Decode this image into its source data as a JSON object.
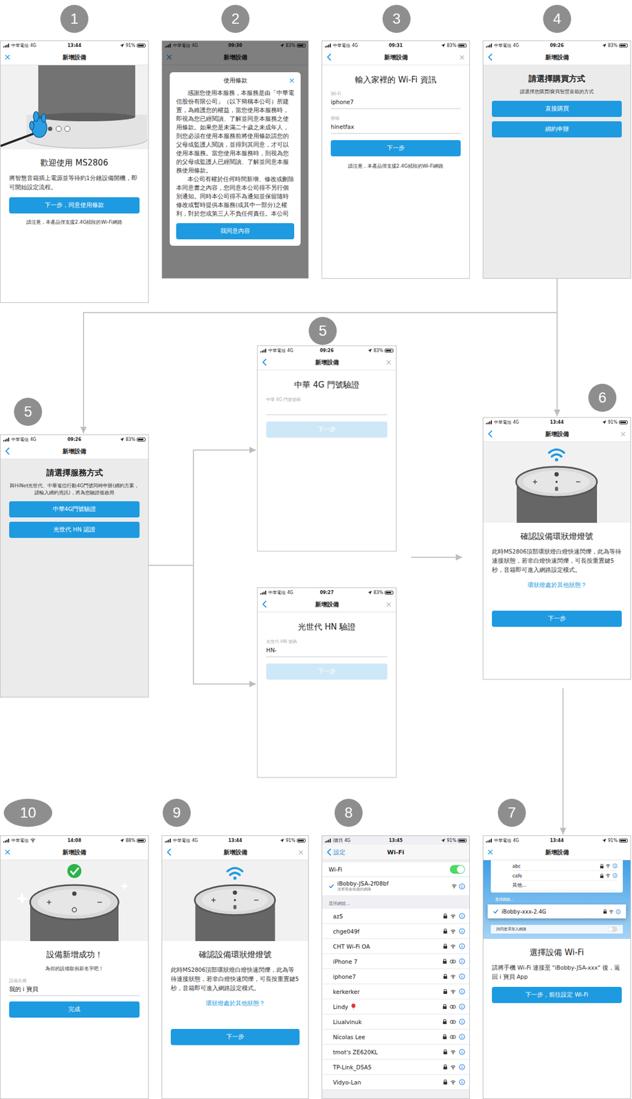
{
  "steps": [
    {
      "label": "1",
      "labelShape": "circle",
      "kind": "welcome",
      "status": {
        "carrier": "中華電信",
        "net": "4G",
        "time": "13:44",
        "battery": "91%",
        "batteryLevel": 0.91
      },
      "nav": {
        "leftIcon": "close",
        "title": "新增設備",
        "rightClose": false
      },
      "title": "歡迎使用 MS2806",
      "body": "將智慧音箱插上電源並等待約1分鐘設備開機，即可開始設定流程。",
      "buttons": [
        {
          "text": "下一步，同意使用條款",
          "disabled": false
        }
      ],
      "note": "請注意，本產品僅支援2.4G頻段的Wi-Fi網路"
    },
    {
      "label": "2",
      "labelShape": "circle",
      "kind": "terms",
      "status": {
        "carrier": "中華電信",
        "net": "4G",
        "time": "09:30",
        "battery": "83%",
        "batteryLevel": 0.83
      },
      "nav": {
        "leftIcon": "close",
        "title": "新增設備",
        "rightClose": false
      },
      "modal": {
        "title": "使用條款",
        "paragraphs": [
          "感謝您使用本服務，本服務是由「中華電信股份有限公司」（以下簡稱本公司）所建置，為維護您的權益，當您使用本服務時，即視為您已經閱讀、了解並同意本服務之使用條款。如果您是未滿二十歲之未成年人，則您必須在使用本服務前將使用條款請您的父母或監護人閱讀，並得到其同意，才可以使用本服務。當您使用本服務時，則視為您的父母或監護人已經閱讀、了解並同意本服務使用條款。",
          "本公司有權於任何時間新增、修改或刪除本同意書之內容，您同意本公司得不另行個別通知。同時本公司得不為通知並保留隨時修改或暫時提供本服務(或其中一部分)之權利，對於您或第三人不負任何責任。本公司"
        ],
        "button": "我同意內容"
      }
    },
    {
      "label": "3",
      "labelShape": "circle",
      "kind": "form",
      "status": {
        "carrier": "中華電信",
        "net": "4G",
        "time": "09:31",
        "battery": "83%",
        "batteryLevel": 0.83
      },
      "nav": {
        "leftIcon": "back",
        "title": "新增設備",
        "rightClose": true
      },
      "title": "輸入家裡的 Wi-Fi 資訊",
      "fields": [
        {
          "label": "Wi-Fi",
          "value": "iphone7"
        },
        {
          "label": "密碼",
          "value": "hinetfax"
        }
      ],
      "buttons": [
        {
          "text": "下一步",
          "disabled": false
        }
      ],
      "note": "請注意，本產品僅支援2.4G頻段的Wi-Fi網路"
    },
    {
      "label": "4",
      "labelShape": "circle",
      "kind": "choice",
      "status": {
        "carrier": "中華電信",
        "net": "4G",
        "time": "09:26",
        "battery": "83%",
        "batteryLevel": 0.83
      },
      "nav": {
        "leftIcon": "back",
        "title": "新增設備",
        "rightClose": false
      },
      "title": "請選擇購買方式",
      "body": "請選擇您購買i寶貝智慧音箱的方式",
      "buttons": [
        {
          "text": "直接購買",
          "disabled": false
        },
        {
          "text": "綁約申辦",
          "disabled": false
        }
      ]
    },
    {
      "label": "5",
      "labelShape": "circle",
      "kind": "choice",
      "status": {
        "carrier": "中華電信",
        "net": "4G",
        "time": "09:26",
        "battery": "83%",
        "batteryLevel": 0.83
      },
      "nav": {
        "leftIcon": "back",
        "title": "新增設備",
        "rightClose": false
      },
      "title": "請選擇服務方式",
      "body": "與HiNet光世代、中華電信行動4G門號同時申辦(綁約方案，請輸入綁約資訊)，將為您驗證後啟用",
      "buttons": [
        {
          "text": "中華4G門號驗證",
          "disabled": false
        },
        {
          "text": "光世代 HN 認證",
          "disabled": false
        }
      ]
    },
    {
      "label": "5",
      "labelShape": "circle",
      "kind": "form",
      "status": {
        "carrier": "中華電信",
        "net": "4G",
        "time": "09:26",
        "battery": "83%",
        "batteryLevel": 0.83
      },
      "nav": {
        "leftIcon": "back",
        "title": "新增設備",
        "rightClose": true
      },
      "title": "中華 4G 門號驗證",
      "fields": [
        {
          "label": "中華 4G 門號號碼",
          "value": ""
        }
      ],
      "buttons": [
        {
          "text": "下一步",
          "disabled": true
        }
      ]
    },
    {
      "kind": "form",
      "status": {
        "carrier": "中華電信",
        "net": "4G",
        "time": "09:27",
        "battery": "83%",
        "batteryLevel": 0.83
      },
      "nav": {
        "leftIcon": "back",
        "title": "新增設備",
        "rightClose": true
      },
      "title": "光世代 HN 驗證",
      "fields": [
        {
          "label": "光世代 HN 號碼",
          "value": "HN-"
        }
      ],
      "buttons": [
        {
          "text": "下一步",
          "disabled": true
        }
      ]
    },
    {
      "label": "6",
      "labelShape": "circle",
      "kind": "status",
      "status": {
        "carrier": "中華電信",
        "net": "4G",
        "time": "13:44",
        "battery": "91%",
        "batteryLevel": 0.91
      },
      "nav": {
        "leftIcon": "back",
        "title": "新增設備",
        "rightClose": true
      },
      "title": "確認設備環狀燈燈號",
      "body": "此時MS2806頂部環狀燈白燈快速閃爍，此為等待連接狀態，若非白燈快速閃爍，可長按重置鍵5秒，音箱即可進入網路設定模式。",
      "link": "環狀燈處於其他狀態？",
      "buttons": [
        {
          "text": "下一步",
          "disabled": false
        }
      ]
    },
    {
      "label": "7",
      "labelShape": "circle",
      "kind": "wifi-pick",
      "status": {
        "carrier": "中華電信",
        "net": "4G",
        "time": "13:44",
        "battery": "91%",
        "batteryLevel": 0.91
      },
      "nav": {
        "leftIcon": "close",
        "title": "新增設備",
        "rightClose": false
      },
      "networks": [
        {
          "name": "abc",
          "locked": true
        },
        {
          "name": "cafe",
          "locked": true
        },
        {
          "name": "其他...",
          "locked": false
        }
      ],
      "sectionLabel": "選擇網路...",
      "pick": {
        "name": "iBobby-xxx-2.4G",
        "selected": true
      },
      "askLabel": "詢問是否加入網路",
      "askOn": false,
      "title": "選擇設備 Wi-Fi",
      "body": "請將手機 Wi-Fi 連接至 \"iBobby-JSA-xxx\" 後，返回 i 寶貝 App",
      "buttons": [
        {
          "text": "下一步，前往設定 Wi-Fi",
          "disabled": false
        }
      ]
    },
    {
      "label": "8",
      "labelShape": "circle",
      "kind": "settings",
      "status": {
        "carrier": "i寶貝",
        "net": "4G",
        "time": "13:45",
        "battery": "91%",
        "batteryLevel": 0.91
      },
      "nav": {
        "leftIcon": "back",
        "leftText": "設定",
        "title": "Wi-Fi",
        "rightClose": false
      },
      "wifiLabel": "Wi-Fi",
      "wifiOn": true,
      "connected": {
        "name": "iBobby-JSA-2f08bf",
        "sub": "沒有安全保護的網路",
        "selected": true
      },
      "sectionLabel": "選擇網路...",
      "networks": [
        {
          "name": "az5",
          "hotspot": false,
          "balloon": false
        },
        {
          "name": "chge049f",
          "hotspot": false,
          "balloon": false
        },
        {
          "name": "CHT Wi-Fi OA",
          "hotspot": false,
          "balloon": false
        },
        {
          "name": "iPhone 7",
          "hotspot": true,
          "balloon": false
        },
        {
          "name": "iphone7",
          "hotspot": false,
          "balloon": false
        },
        {
          "name": "kerkerker",
          "hotspot": false,
          "balloon": false
        },
        {
          "name": "Lindy",
          "hotspot": true,
          "balloon": true
        },
        {
          "name": "Liualvinuk",
          "hotspot": true,
          "balloon": false
        },
        {
          "name": "Nicolas Lee",
          "hotspot": true,
          "balloon": false
        },
        {
          "name": "tmot's ZE620KL",
          "hotspot": false,
          "balloon": false
        },
        {
          "name": "TP-Link_D5A5",
          "hotspot": false,
          "balloon": false
        },
        {
          "name": "Vidyo-Lan",
          "hotspot": false,
          "balloon": false
        }
      ]
    },
    {
      "label": "9",
      "labelShape": "circle",
      "kind": "status",
      "status": {
        "carrier": "中華電信",
        "net": "4G",
        "time": "13:44",
        "battery": "91%",
        "batteryLevel": 0.91
      },
      "nav": {
        "leftIcon": "back",
        "title": "新增設備",
        "rightClose": true
      },
      "title": "確認設備環狀燈燈號",
      "body": "此時MS2806頂部環狀燈白燈快速閃爍，此為等待連接狀態，若非白燈快速閃爍，可長按重置鍵5秒，音箱即可進入網路設定模式。",
      "link": "環狀燈處於其他狀態？",
      "buttons": [
        {
          "text": "下一步",
          "disabled": false
        }
      ]
    },
    {
      "label": "10",
      "labelShape": "ellipse",
      "kind": "success",
      "status": {
        "carrier": "中華電信",
        "wifi": true,
        "time": "14:08",
        "battery": "88%",
        "batteryLevel": 0.88
      },
      "nav": {
        "leftIcon": "close",
        "title": "新增設備",
        "rightClose": false
      },
      "title": "設備新增成功！",
      "body": "為你的設備取個新名字吧！",
      "fields": [
        {
          "label": "設備名稱",
          "value": "我的 i 寶貝"
        }
      ],
      "buttons": [
        {
          "text": "完成",
          "disabled": false
        }
      ]
    }
  ]
}
